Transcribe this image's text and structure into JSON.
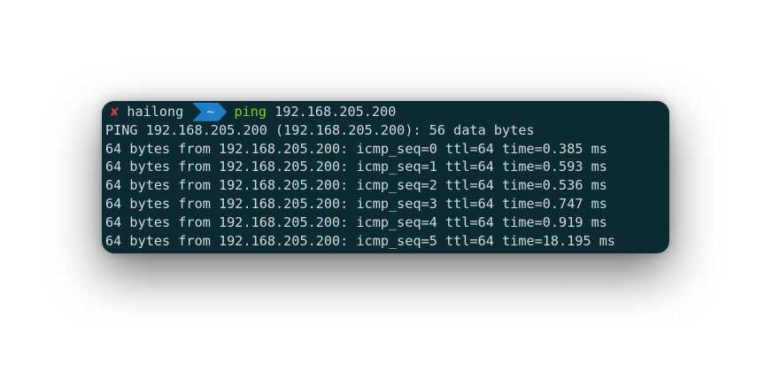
{
  "prompt": {
    "status_icon": "✘",
    "user": "hailong",
    "dir": "~",
    "command": "ping",
    "args": "192.168.205.200"
  },
  "output": [
    "PING 192.168.205.200 (192.168.205.200): 56 data bytes",
    "64 bytes from 192.168.205.200: icmp_seq=0 ttl=64 time=0.385 ms",
    "64 bytes from 192.168.205.200: icmp_seq=1 ttl=64 time=0.593 ms",
    "64 bytes from 192.168.205.200: icmp_seq=2 ttl=64 time=0.536 ms",
    "64 bytes from 192.168.205.200: icmp_seq=3 ttl=64 time=0.747 ms",
    "64 bytes from 192.168.205.200: icmp_seq=4 ttl=64 time=0.919 ms",
    "64 bytes from 192.168.205.200: icmp_seq=5 ttl=64 time=18.195 ms"
  ],
  "colors": {
    "background": "#0c2a32",
    "text": "#d2dadc",
    "error": "#e0383a",
    "dir_segment": "#1e7ec8",
    "command": "#7ed321"
  }
}
